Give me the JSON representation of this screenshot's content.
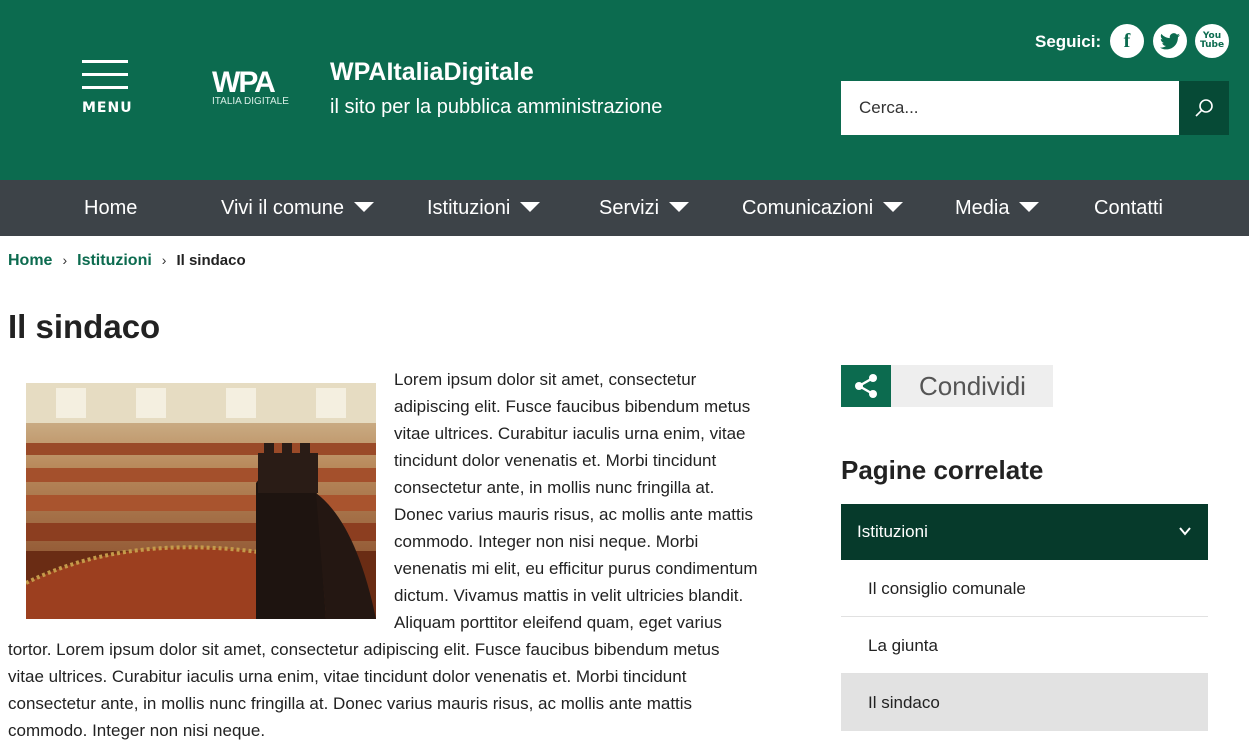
{
  "header": {
    "menu_label": "MENU",
    "logo_mark": "WPA",
    "logo_sub": "ITALIA DIGITALE",
    "site_title": "WPAItaliaDigitale",
    "site_subtitle": "il sito per la pubblica amministrazione",
    "follow_label": "Seguici:",
    "social": [
      {
        "name": "facebook-icon",
        "glyph": "f"
      },
      {
        "name": "twitter-icon",
        "glyph": ""
      },
      {
        "name": "youtube-icon",
        "glyph": "You Tube"
      }
    ],
    "search_placeholder": "Cerca...",
    "colors": {
      "primary": "#0c6b4f",
      "dark": "#064a36",
      "nav": "#3d4348"
    }
  },
  "nav": {
    "items": [
      {
        "label": "Home",
        "dropdown": false
      },
      {
        "label": "Vivi il comune",
        "dropdown": true
      },
      {
        "label": "Istituzioni",
        "dropdown": true
      },
      {
        "label": "Servizi",
        "dropdown": true
      },
      {
        "label": "Comunicazioni",
        "dropdown": true
      },
      {
        "label": "Media",
        "dropdown": true
      },
      {
        "label": "Contatti",
        "dropdown": false
      }
    ]
  },
  "breadcrumb": {
    "items": [
      "Home",
      "Istituzioni"
    ],
    "current": "Il sindaco",
    "separator": "›"
  },
  "page": {
    "title": "Il sindaco",
    "body": "Lorem ipsum dolor sit amet, consectetur adipiscing elit. Fusce faucibus bibendum metus vitae ultrices. Curabitur iaculis urna enim, vitae tincidunt dolor venenatis et. Morbi tincidunt consectetur ante, in mollis nunc fringilla at. Donec varius mauris risus, ac mollis ante mattis commodo. Integer non nisi neque. Morbi venenatis mi elit, eu efficitur purus condimentum dictum. Vivamus mattis in velit ultricies blandit. Aliquam porttitor eleifend quam, eget varius tortor. Lorem ipsum dolor sit amet, consectetur adipiscing elit. Fusce faucibus bibendum metus vitae ultrices. Curabitur iaculis urna enim, vitae tincidunt dolor venenatis et. Morbi tincidunt consectetur ante, in mollis nunc fringilla at. Donec varius mauris risus, ac mollis ante mattis commodo. Integer non nisi neque."
  },
  "sidebar": {
    "share_label": "Condividi",
    "related_title": "Pagine correlate",
    "accordion_label": "Istituzioni",
    "items": [
      {
        "label": "Il consiglio comunale",
        "active": false
      },
      {
        "label": "La giunta",
        "active": false
      },
      {
        "label": "Il sindaco",
        "active": true
      }
    ]
  }
}
